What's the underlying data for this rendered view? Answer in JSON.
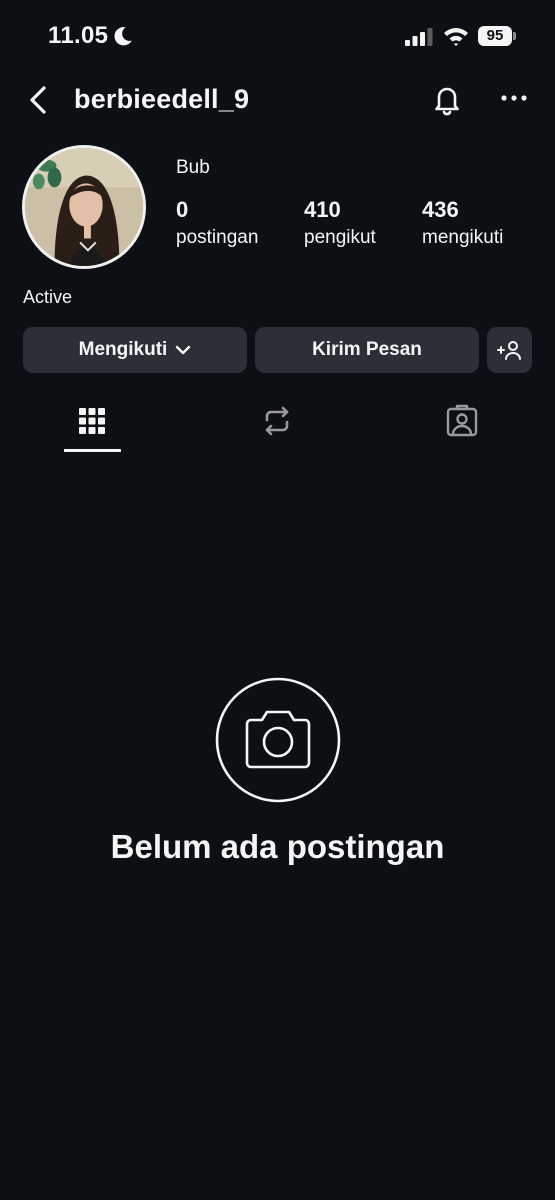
{
  "status_bar": {
    "time": "11.05",
    "battery": "95"
  },
  "header": {
    "username": "berbieedell_9"
  },
  "profile": {
    "display_name": "Bub",
    "bio": "Active",
    "stats": {
      "posts": {
        "value": "0",
        "label": "postingan"
      },
      "followers": {
        "value": "410",
        "label": "pengikut"
      },
      "following": {
        "value": "436",
        "label": "mengikuti"
      }
    }
  },
  "actions": {
    "following_label": "Mengikuti",
    "message_label": "Kirim Pesan"
  },
  "tabs": [
    {
      "icon": "grid-icon",
      "active": true
    },
    {
      "icon": "reposts-icon",
      "active": false
    },
    {
      "icon": "tagged-icon",
      "active": false
    }
  ],
  "empty_state": {
    "icon": "camera-icon",
    "title": "Belum ada postingan"
  },
  "colors": {
    "background": "#0c1014",
    "button": "#2b3036",
    "text": "#f5f5f5"
  }
}
